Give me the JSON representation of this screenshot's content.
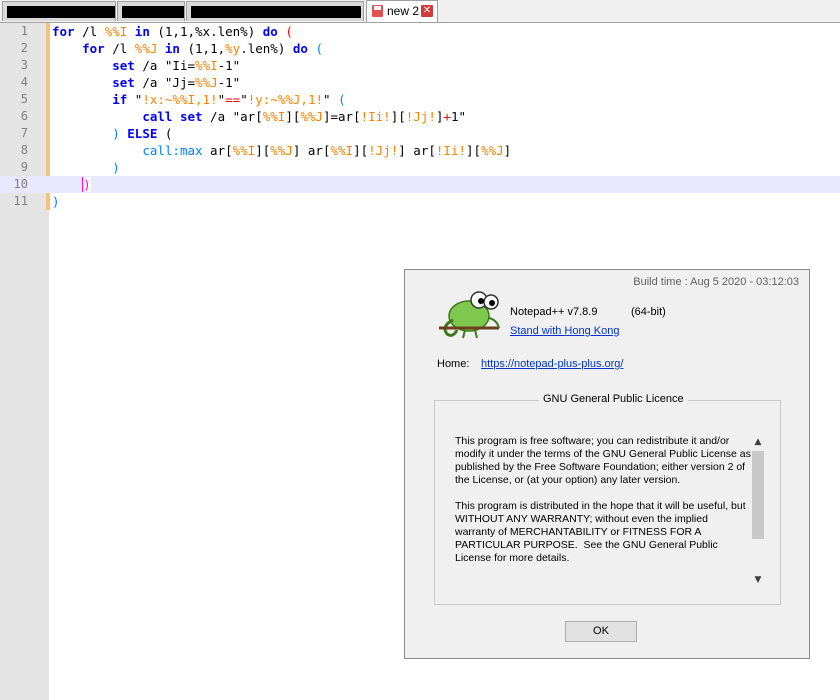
{
  "tabs": [
    {
      "label": "",
      "redacted": true
    },
    {
      "label": "",
      "redacted": true
    },
    {
      "label": "",
      "redacted": true
    },
    {
      "label": "new 2",
      "active": true
    }
  ],
  "editor": {
    "line_numbers": [
      "1",
      "2",
      "3",
      "4",
      "5",
      "6",
      "7",
      "8",
      "9",
      "10",
      "11"
    ],
    "current_line": 10
  },
  "about": {
    "build_time": "Build time : Aug  5 2020 - 03:12:03",
    "app_name": "Notepad++ v7.8.9",
    "bits": "(64-bit)",
    "slogan_link": "Stand with Hong Kong",
    "home_label": "Home:",
    "home_url": "https://notepad-plus-plus.org/",
    "license_title": "GNU General Public Licence",
    "license_text": "This program is free software; you can redistribute it and/or modify it under the terms of the GNU General Public License as published by the Free Software Foundation; either version 2 of the License, or (at your option) any later version.\n\nThis program is distributed in the hope that it will be useful, but WITHOUT ANY WARRANTY; without even the implied warranty of MERCHANTABILITY or FITNESS FOR A PARTICULAR PURPOSE.  See the GNU General Public License for more details.",
    "ok_label": "OK",
    "scroll_up": "▲",
    "scroll_down": "▼"
  },
  "colors": {
    "keyword": "#0000ff",
    "variable": "#ff8000",
    "operator": "#ff0000",
    "label": "#0080ff",
    "fold_bar": "#f5c27a",
    "current_line_bg": "#e8e8ff"
  }
}
